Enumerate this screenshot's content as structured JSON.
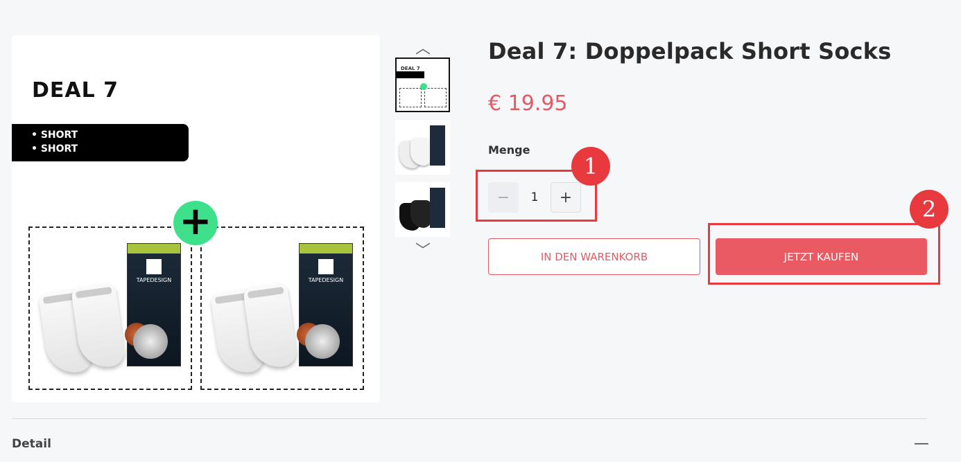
{
  "gallery": {
    "main": {
      "deal_title": "DEAL 7",
      "list_items": [
        "• SHORT",
        "• SHORT"
      ],
      "plus_symbol": "+",
      "pack_brand": "TAPEDESIGN"
    },
    "thumbnails": [
      {
        "label": "DEAL 7"
      },
      {
        "label": ""
      },
      {
        "label": ""
      }
    ],
    "arrow_up": "︿",
    "arrow_down": "﹀"
  },
  "product": {
    "title": "Deal 7: Doppelpack Short Socks",
    "price": "€ 19.95",
    "quantity_label": "Menge",
    "quantity_value": "1",
    "minus_symbol": "−",
    "plus_symbol": "+"
  },
  "actions": {
    "add_to_cart": "IN DEN WARENKORB",
    "buy_now": "JETZT KAUFEN"
  },
  "annotations": [
    {
      "number": "1"
    },
    {
      "number": "2"
    }
  ],
  "detail": {
    "label": "Detail",
    "toggle_symbol": "—"
  },
  "colors": {
    "accent": "#e95a63",
    "annotation": "#e8393f",
    "plus_badge": "#3ee08c"
  }
}
